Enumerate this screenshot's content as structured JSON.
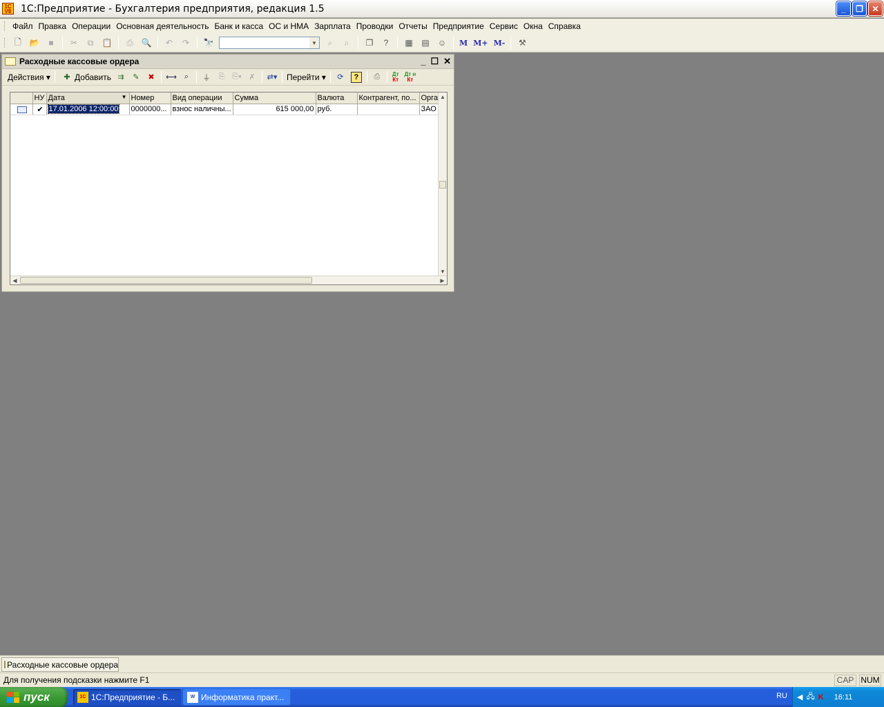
{
  "app": {
    "title": "1С:Предприятие - Бухгалтерия предприятия, редакция 1.5",
    "icon_text": "1C V8"
  },
  "menu": [
    "Файл",
    "Правка",
    "Операции",
    "Основная деятельность",
    "Банк и касса",
    "ОС и НМА",
    "Зарплата",
    "Проводки",
    "Отчеты",
    "Предприятие",
    "Сервис",
    "Окна",
    "Справка"
  ],
  "toolbar": {
    "search_value": "",
    "m_label": "М",
    "m_plus_label": "М+",
    "m_minus_label": "М-"
  },
  "document": {
    "title": "Расходные кассовые ордера",
    "actions_label": "Действия",
    "add_label": "Добавить",
    "goto_label": "Перейти",
    "help_label": "?",
    "dt_label": "Дт",
    "kt_label": "Кт",
    "dtn_label": "Дт н",
    "ktn_label": "Кт"
  },
  "table": {
    "columns": [
      "",
      "НУ",
      "Дата",
      "Номер",
      "Вид операции",
      "Сумма",
      "Валюта",
      "Контрагент, по...",
      "Орга"
    ],
    "rows": [
      {
        "nu": "✔",
        "date": "17.01.2006 12:00:00",
        "number": "0000000...",
        "operation": "взнос наличны...",
        "amount": "615 000,00",
        "currency": "руб.",
        "contractor": "",
        "org": "ЗАО"
      }
    ]
  },
  "window_tabs": [
    "Расходные кассовые ордера"
  ],
  "status": {
    "hint": "Для получения подсказки нажмите F1",
    "cap": "CAP",
    "num": "NUM"
  },
  "taskbar": {
    "start_label": "пуск",
    "tasks": [
      "1С:Предприятие - Б...",
      "Информатика практ..."
    ],
    "lang": "RU",
    "time": "16:11"
  }
}
